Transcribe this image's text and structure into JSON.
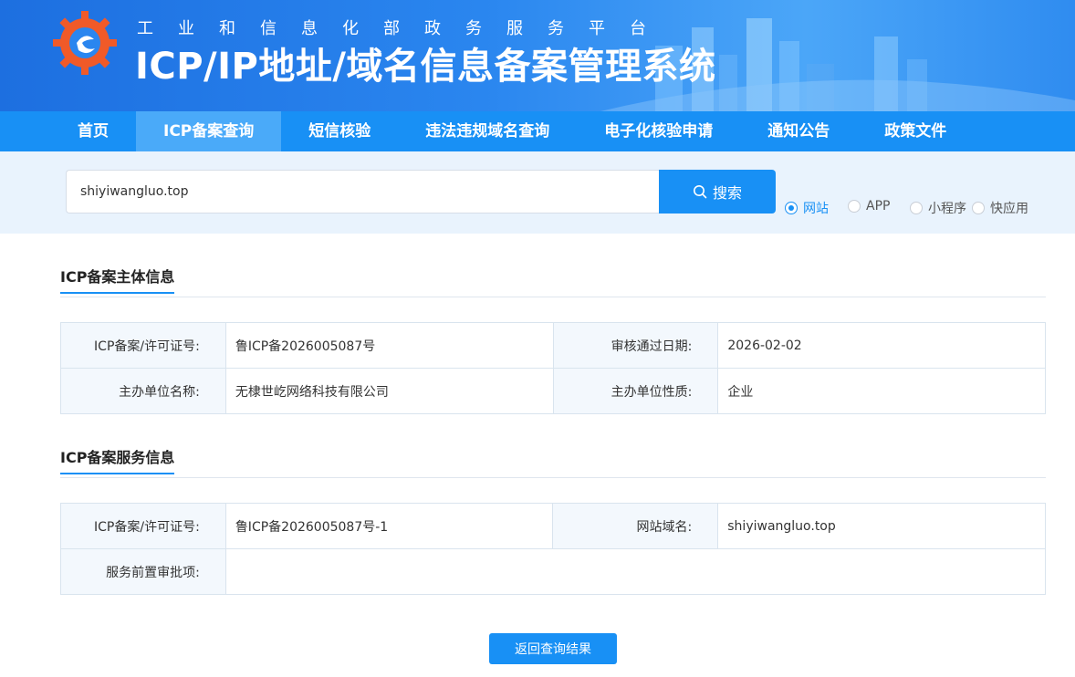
{
  "header": {
    "subtitle": "工业和信息化部政务服务平台",
    "title": "ICP/IP地址/域名信息备案管理系统"
  },
  "nav": {
    "items": [
      {
        "label": "首页",
        "active": false
      },
      {
        "label": "ICP备案查询",
        "active": true
      },
      {
        "label": "短信核验",
        "active": false
      },
      {
        "label": "违法违规域名查询",
        "active": false
      },
      {
        "label": "电子化核验申请",
        "active": false
      },
      {
        "label": "通知公告",
        "active": false
      },
      {
        "label": "政策文件",
        "active": false
      }
    ]
  },
  "search": {
    "value": "shiyiwangluo.top",
    "button_label": "搜索",
    "options": [
      {
        "label": "网站",
        "checked": true
      },
      {
        "label": "APP",
        "checked": false
      },
      {
        "label": "小程序",
        "checked": false
      },
      {
        "label": "快应用",
        "checked": false
      }
    ]
  },
  "subject_info": {
    "title": "ICP备案主体信息",
    "license_label": "ICP备案/许可证号:",
    "license_value": "鲁ICP备2026005087号",
    "approve_date_label": "审核通过日期:",
    "approve_date_value": "2026-02-02",
    "org_name_label": "主办单位名称:",
    "org_name_value": "无棣世屹网络科技有限公司",
    "org_type_label": "主办单位性质:",
    "org_type_value": "企业"
  },
  "service_info": {
    "title": "ICP备案服务信息",
    "license_label": "ICP备案/许可证号:",
    "license_value": "鲁ICP备2026005087号-1",
    "domain_label": "网站域名:",
    "domain_value": "shiyiwangluo.top",
    "preapproval_label": "服务前置审批项:",
    "preapproval_value": ""
  },
  "back_button_label": "返回查询结果",
  "colors": {
    "primary": "#1890f5",
    "nav_active": "#4aaaf9",
    "search_band": "#e9f3fd"
  }
}
